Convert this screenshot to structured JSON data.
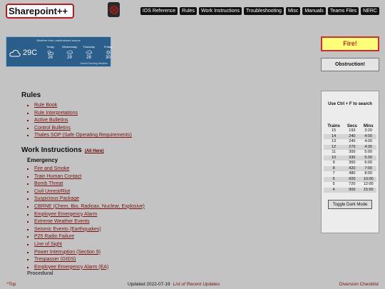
{
  "header": {
    "logo": "Sharepoint++",
    "nav": [
      "IOS Reference",
      "Rules",
      "Work Instructions",
      "Troubleshooting",
      "Misc",
      "Manuals",
      "Teams Files",
      "NERC"
    ]
  },
  "weather": {
    "title": "Weather from unauthorized source",
    "current_temp": "29C",
    "days": [
      {
        "label": "Today",
        "temp": "26",
        "icon": "cloud-sun-icon"
      },
      {
        "label": "Wednesday",
        "temp": "29",
        "icon": "rain-cloud-icon"
      },
      {
        "label": "Thursday",
        "temp": "28",
        "icon": "rain-cloud-icon"
      },
      {
        "label": "Friday",
        "temp": "30",
        "icon": "sun-icon"
      }
    ],
    "footer": "Harold Dunning Weather"
  },
  "buttons": {
    "fire": "Fire!",
    "obstruction": "Obstruction!",
    "dark_mode": "Toggle Dark Mode"
  },
  "rules": {
    "title": "Rules",
    "items": [
      "Rule Book",
      "Rule Interpretations",
      "Active Bulletins",
      "Control Bulletins",
      "Thales SOP (Safe Operating Requirements)"
    ]
  },
  "work": {
    "title": "Work Instructions",
    "all_link": "(All Here)",
    "emergency_title": "Emergency",
    "items": [
      "Fire and Smoke",
      "Train Human Contact",
      "Bomb Threat",
      "Civil Unrest/Riot",
      "Suspicious Package",
      "CBRNE (Chem, Bio, Radioax, Nuclear, Explosive)",
      "Employee Emergency Alarm",
      "Extreme Weather Events",
      "Seismic Events (Earthquakes)",
      "P25 Radio Failure",
      "Line of Sight",
      "Power Interruption (Section 9)",
      "Trespasser (GIDS)",
      "Employee Emergency Alarm (EA)"
    ],
    "next_section": "Procedural"
  },
  "panel": {
    "tip": "Use Ctrl + F to search",
    "headers": [
      "Trains",
      "Secs",
      "Mins"
    ],
    "rows": [
      [
        "15",
        "193",
        "3:20"
      ],
      [
        "14",
        "240",
        "4:00"
      ],
      [
        "13",
        "240",
        "4:00"
      ],
      [
        "12",
        "270",
        "4:30"
      ],
      [
        "11",
        "300",
        "5:00"
      ],
      [
        "10",
        "330",
        "5:30"
      ],
      [
        "9",
        "360",
        "6:00"
      ],
      [
        "8",
        "420",
        "7:00"
      ],
      [
        "7",
        "480",
        "8:00"
      ],
      [
        "6",
        "600",
        "10:00"
      ],
      [
        "5",
        "720",
        "12:00"
      ],
      [
        "4",
        "900",
        "15:00"
      ]
    ]
  },
  "footer": {
    "top": "^Top",
    "updated": "Updated 2022-07-19",
    "recent": "List of Recent Updates",
    "diversion": "Diversion Checklist"
  }
}
